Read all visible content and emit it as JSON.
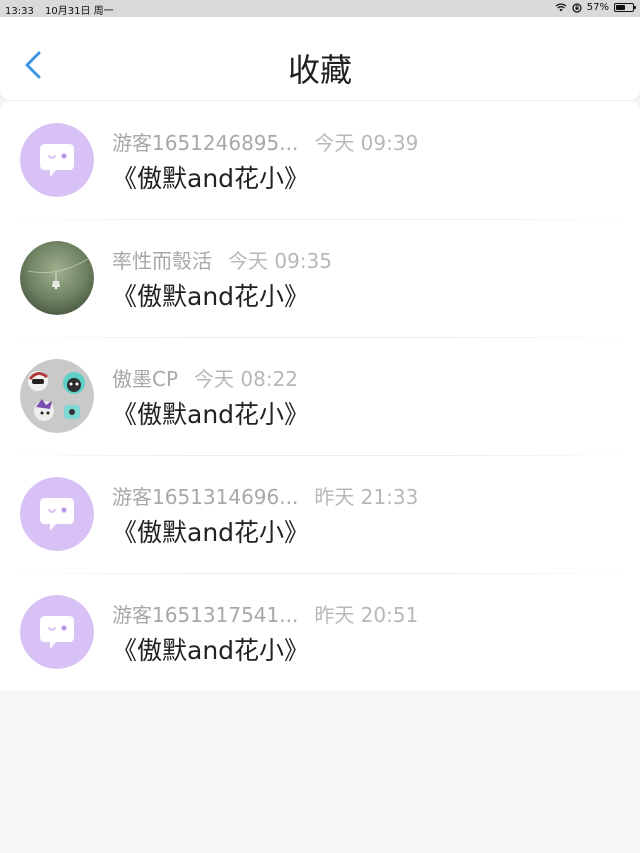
{
  "status": {
    "time": "13:33",
    "date": "10月31日 周一",
    "battery": "57%",
    "battery_level": 0.57
  },
  "header": {
    "title": "收藏"
  },
  "items": [
    {
      "name": "游客1651246895...",
      "time": "今天 09:39",
      "title": "《傲默and花小》",
      "avatar": "chat-bubble-avatar"
    },
    {
      "name": "率性而彀活",
      "time": "今天 09:35",
      "title": "《傲默and花小》",
      "avatar": "photo-avatar"
    },
    {
      "name": "傲墨CP",
      "time": "今天 08:22",
      "title": "《傲默and花小》",
      "avatar": "cartoon-avatar"
    },
    {
      "name": "游客1651314696...",
      "time": "昨天 21:33",
      "title": "《傲默and花小》",
      "avatar": "chat-bubble-avatar"
    },
    {
      "name": "游客1651317541...",
      "time": "昨天 20:51",
      "title": "《傲默and花小》",
      "avatar": "chat-bubble-avatar"
    }
  ],
  "colors": {
    "accent": "#3b96e8",
    "avatar_purple": "#d8c2f5"
  }
}
